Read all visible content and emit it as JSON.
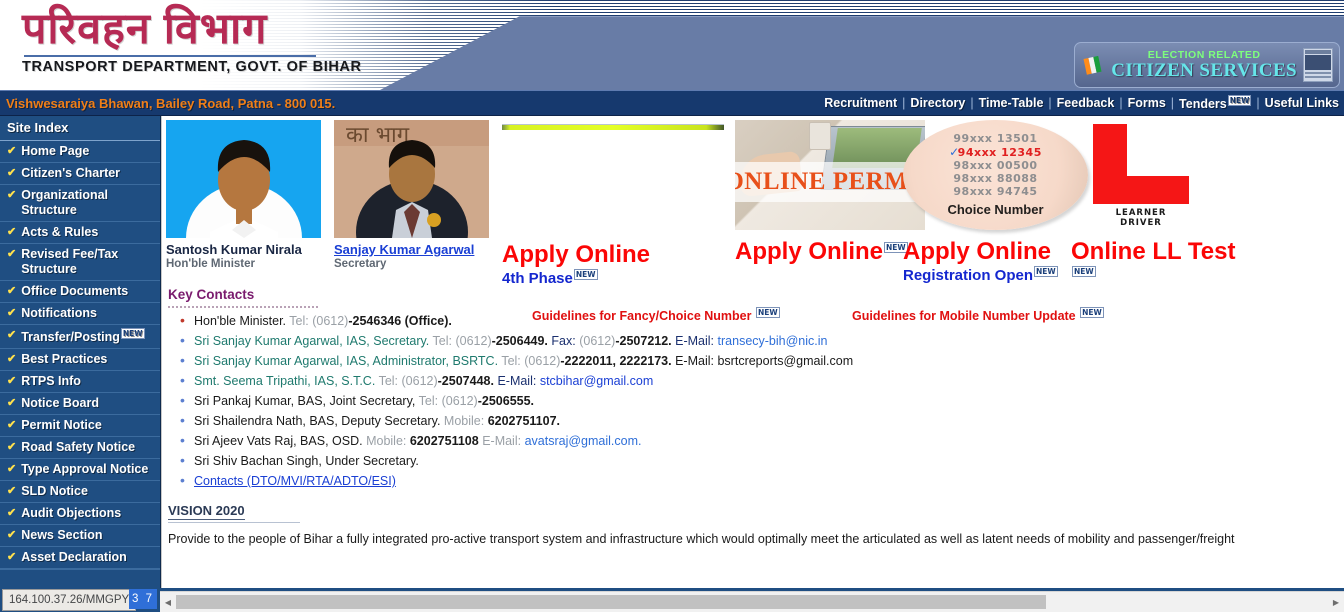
{
  "header": {
    "logo_hindi": "परिवहन विभाग",
    "logo_english": "TRANSPORT DEPARTMENT, GOVT. OF BIHAR",
    "badge_line1": "ELECTION RELATED",
    "badge_line2": "CITIZEN SERVICES",
    "address": "Vishwesaraiya Bhawan, Bailey Road, Patna - 800 015."
  },
  "nav": {
    "items": [
      {
        "label": "Recruitment",
        "new": false
      },
      {
        "label": "Directory",
        "new": false
      },
      {
        "label": "Time-Table",
        "new": false
      },
      {
        "label": "Feedback",
        "new": false
      },
      {
        "label": "Forms",
        "new": false
      },
      {
        "label": "Tenders",
        "new": true
      },
      {
        "label": "Useful Links",
        "new": false
      }
    ],
    "separator": "|",
    "new_label": "NEW"
  },
  "sidebar": {
    "title": "Site Index",
    "check": "✔",
    "items": [
      {
        "label": "Home Page",
        "new": false
      },
      {
        "label": "Citizen's Charter",
        "new": false
      },
      {
        "label": "Organizational Structure",
        "new": false
      },
      {
        "label": "Acts & Rules",
        "new": false
      },
      {
        "label": "Revised Fee/Tax Structure",
        "new": false
      },
      {
        "label": "Office Documents",
        "new": false
      },
      {
        "label": "Notifications",
        "new": false
      },
      {
        "label": "Transfer/Posting",
        "new": true
      },
      {
        "label": "Best Practices",
        "new": false
      },
      {
        "label": "RTPS Info",
        "new": false
      },
      {
        "label": "Notice Board",
        "new": false
      },
      {
        "label": "Permit Notice",
        "new": false
      },
      {
        "label": "Road Safety Notice",
        "new": false
      },
      {
        "label": "Type Approval Notice",
        "new": false
      },
      {
        "label": "SLD Notice",
        "new": false
      },
      {
        "label": "Audit Objections",
        "new": false
      },
      {
        "label": "News Section",
        "new": false
      },
      {
        "label": "Asset Declaration",
        "new": false
      }
    ]
  },
  "officials": [
    {
      "name": "Santosh Kumar Nirala",
      "role": "Hon'ble Minister",
      "is_link": false
    },
    {
      "name": "Sanjay Kumar Agarwal",
      "role": "Secretary",
      "is_link": true
    }
  ],
  "banners": [
    {
      "title": "Apply Online",
      "subtitle": "4th Phase",
      "new": true,
      "image": "yellow-strip-banner"
    },
    {
      "title": "Apply Online",
      "subtitle": "",
      "new": true,
      "image": "online-permit-banner",
      "image_text": "ONLINE PERMIT"
    },
    {
      "title": "Apply Online",
      "subtitle": "Registration Open",
      "new": true,
      "image": "choice-number-banner"
    },
    {
      "title": "Online LL Test",
      "subtitle": "",
      "new": true,
      "image": "learner-driver-banner"
    }
  ],
  "choice_number_image": {
    "rows": [
      "99xxx 13501",
      "94xxx 12345",
      "98xxx 00500",
      "98xxx 88088",
      "98xxx 94745"
    ],
    "highlight_index": 1,
    "label": "Choice Number"
  },
  "learner_image": {
    "caption": "LEARNER DRIVER"
  },
  "contacts": {
    "heading": "Key Contacts",
    "items": [
      {
        "name": "Hon'ble Minister.",
        "tel_label": "Tel:",
        "code": "(0612)",
        "number": "-2546346 (Office).",
        "name_color": "plain"
      },
      {
        "name": "Sri Sanjay Kumar Agarwal, IAS, Secretary.",
        "tel_label": "Tel:",
        "code": "(0612)",
        "number": "-2506449.",
        "fax_label": "Fax:",
        "fax_code": "(0612)",
        "fax_number": "-2507212.",
        "email_label": "E-Mail:",
        "email": "transecy-bih@nic.in",
        "name_color": "teal"
      },
      {
        "name": "Sri Sanjay Kumar Agarwal, IAS, Administrator, BSRTC.",
        "tel_label": "Tel:",
        "code": "(0612)",
        "number": "-2222011, 2222173.",
        "email_label": "E-Mail:",
        "email": "bsrtcreports@gmail.com",
        "name_color": "teal"
      },
      {
        "name": "Smt. Seema Tripathi, IAS, S.T.C.",
        "tel_label": "Tel:",
        "code": "(0612)",
        "number": "-2507448.",
        "email_label": "E-Mail:",
        "email": "stcbihar@gmail.com",
        "name_color": "teal"
      },
      {
        "name": "Sri Pankaj Kumar, BAS, Joint Secretary,",
        "tel_label": "Tel:",
        "code": "(0612)",
        "number": "-2506555.",
        "name_color": "plain"
      },
      {
        "name": "Sri Shailendra Nath, BAS, Deputy Secretary.",
        "tel_label": "Mobile:",
        "code": "",
        "number": "6202751107.",
        "name_color": "plain"
      },
      {
        "name": "Sri Ajeev Vats Raj, BAS, OSD.",
        "tel_label": "Mobile:",
        "code": "",
        "number": "6202751108",
        "email_label": "E-Mail:",
        "email": "avatsraj@gmail.com.",
        "name_color": "plain"
      },
      {
        "name": "Sri Shiv Bachan Singh, Under Secretary.",
        "name_color": "plain"
      }
    ],
    "contacts_link": "Contacts (DTO/MVI/RTA/ADTO/ESI)"
  },
  "guidelines": [
    {
      "label": "Guidelines for Fancy/Choice Number",
      "new": true
    },
    {
      "label": "Guidelines for Mobile Number Update",
      "new": true
    }
  ],
  "vision": {
    "heading": "VISION 2020",
    "text": "Provide to the people of Bihar a fully integrated pro-active transport system and infrastructure which would optimally meet the articulated as well as latent needs of mobility and passenger/freight"
  },
  "statusbar": {
    "url": "164.100.37.26/MMGPY",
    "selection": "3 7"
  }
}
